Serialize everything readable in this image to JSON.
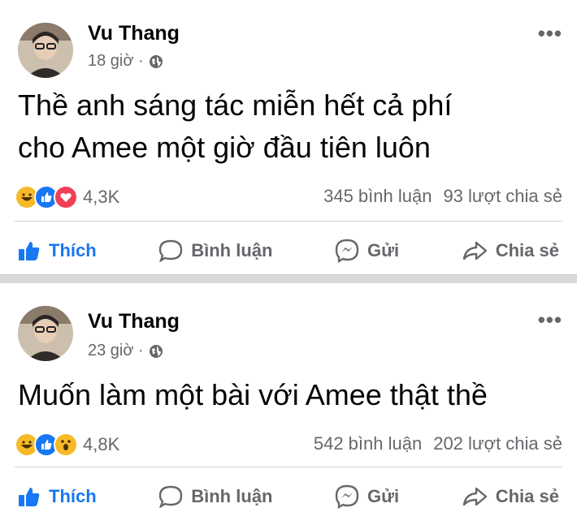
{
  "posts": [
    {
      "author": "Vu Thang",
      "time": "18 giờ ·",
      "text": "Thề anh sáng tác miễn hết cả phí\ncho Amee một giờ đầu tiên luôn",
      "reactions": {
        "icons": [
          "haha-icon",
          "like-icon",
          "love-icon"
        ],
        "count": "4,3K"
      },
      "comments": "345 bình luận",
      "shares": "93 lượt chia sẻ"
    },
    {
      "author": "Vu Thang",
      "time": "23 giờ ·",
      "text": "Muốn làm một bài với Amee thật thề",
      "reactions": {
        "icons": [
          "haha-icon",
          "like-icon",
          "wow-icon"
        ],
        "count": "4,8K"
      },
      "comments": "542 bình luận",
      "shares": "202 lượt chia sẻ"
    }
  ],
  "actions": {
    "like": "Thích",
    "comment": "Bình luận",
    "send": "Gửi",
    "share": "Chia sẻ"
  },
  "more": "•••",
  "colors": {
    "like_blue": "#1877f2",
    "love_red": "#f33e58",
    "haha_yellow": "#f7b928",
    "gray_text": "#65676b"
  }
}
